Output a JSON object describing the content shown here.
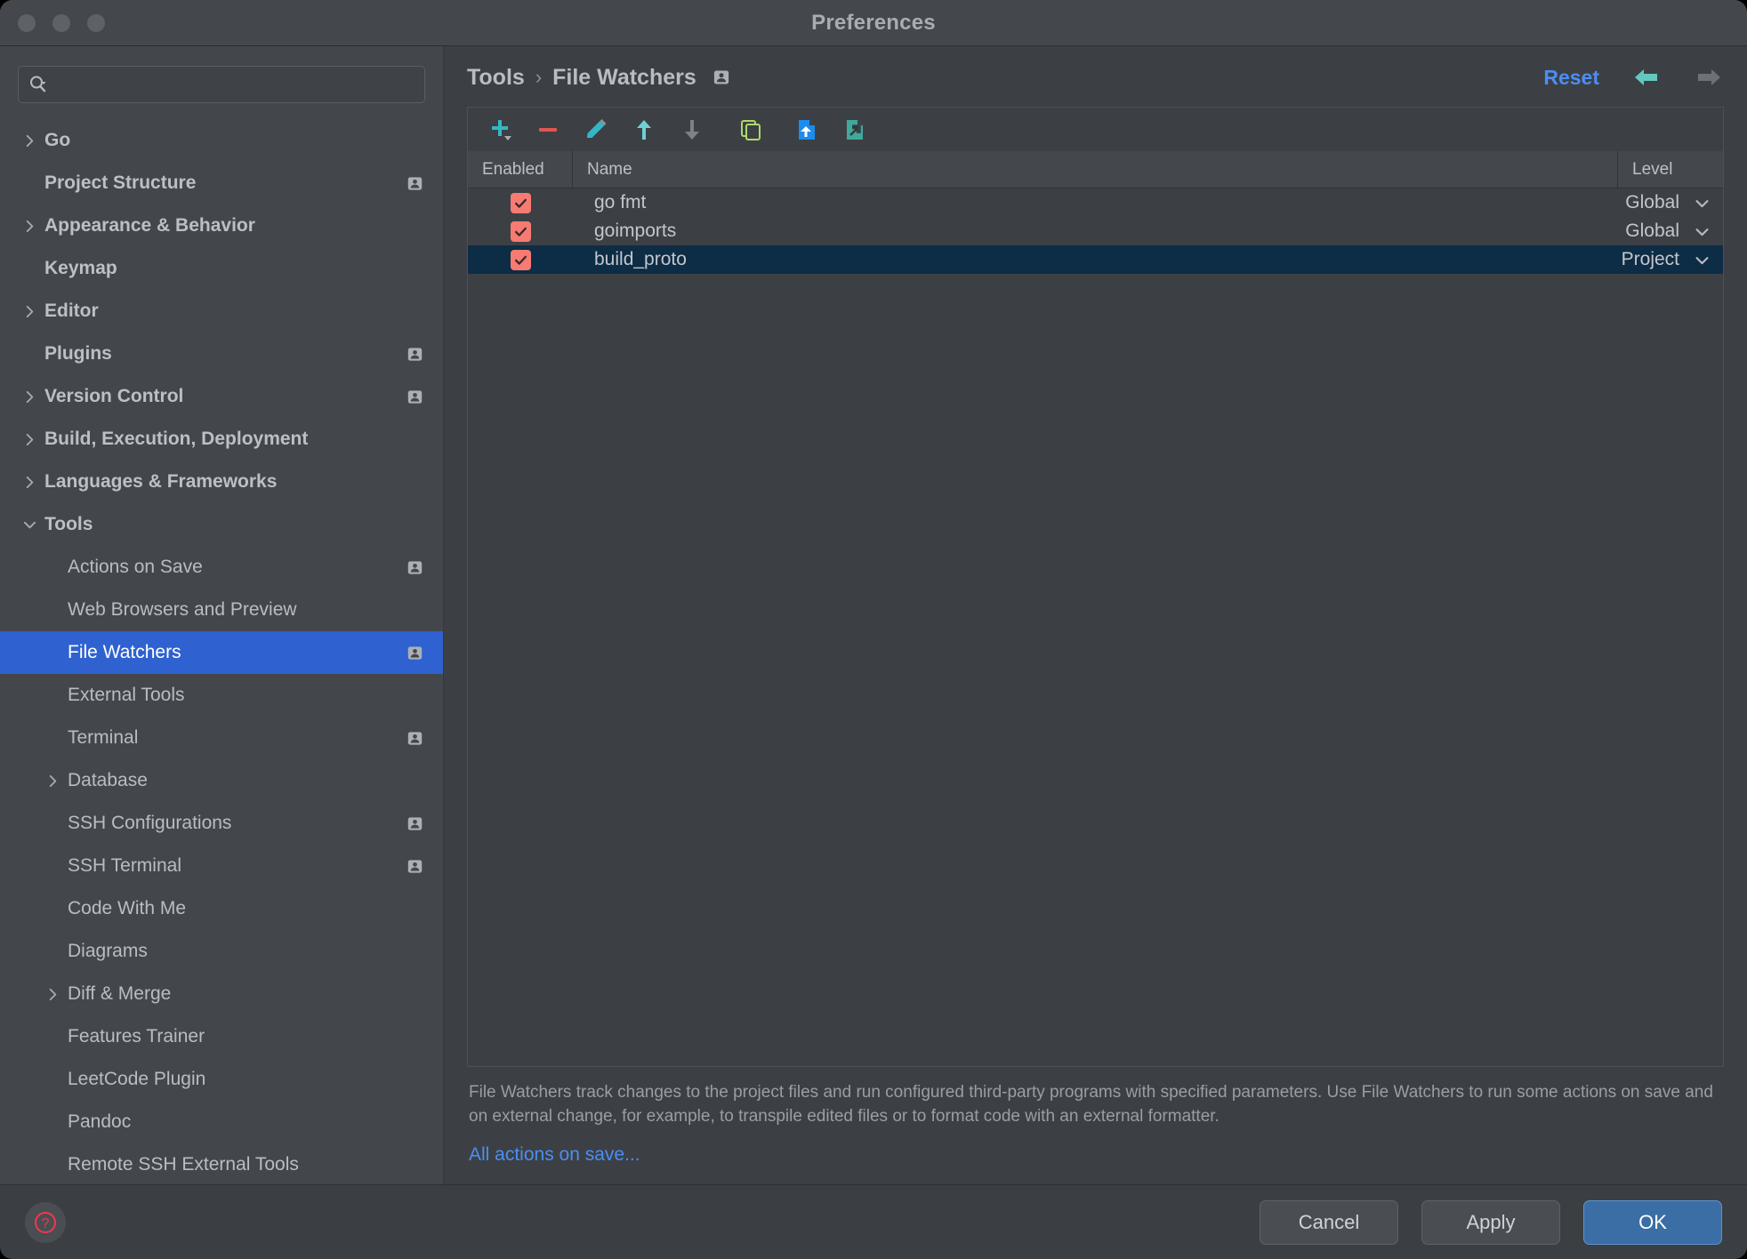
{
  "window": {
    "title": "Preferences",
    "traffic_lights": [
      "close",
      "minimize",
      "zoom"
    ]
  },
  "search": {
    "placeholder": "",
    "value": "",
    "icon": "search-icon"
  },
  "sidebar": {
    "items": [
      {
        "label": "Go",
        "level": 0,
        "expandable": true,
        "expanded": false,
        "bold": true,
        "badge": false,
        "selected": false
      },
      {
        "label": "Project Structure",
        "level": 0,
        "expandable": false,
        "expanded": false,
        "bold": true,
        "badge": true,
        "selected": false
      },
      {
        "label": "Appearance & Behavior",
        "level": 0,
        "expandable": true,
        "expanded": false,
        "bold": true,
        "badge": false,
        "selected": false
      },
      {
        "label": "Keymap",
        "level": 0,
        "expandable": false,
        "expanded": false,
        "bold": true,
        "badge": false,
        "selected": false
      },
      {
        "label": "Editor",
        "level": 0,
        "expandable": true,
        "expanded": false,
        "bold": true,
        "badge": false,
        "selected": false
      },
      {
        "label": "Plugins",
        "level": 0,
        "expandable": false,
        "expanded": false,
        "bold": true,
        "badge": true,
        "selected": false
      },
      {
        "label": "Version Control",
        "level": 0,
        "expandable": true,
        "expanded": false,
        "bold": true,
        "badge": true,
        "selected": false
      },
      {
        "label": "Build, Execution, Deployment",
        "level": 0,
        "expandable": true,
        "expanded": false,
        "bold": true,
        "badge": false,
        "selected": false
      },
      {
        "label": "Languages & Frameworks",
        "level": 0,
        "expandable": true,
        "expanded": false,
        "bold": true,
        "badge": false,
        "selected": false
      },
      {
        "label": "Tools",
        "level": 0,
        "expandable": true,
        "expanded": true,
        "bold": true,
        "badge": false,
        "selected": false
      },
      {
        "label": "Actions on Save",
        "level": 1,
        "expandable": false,
        "expanded": false,
        "bold": false,
        "badge": true,
        "selected": false
      },
      {
        "label": "Web Browsers and Preview",
        "level": 1,
        "expandable": false,
        "expanded": false,
        "bold": false,
        "badge": false,
        "selected": false
      },
      {
        "label": "File Watchers",
        "level": 1,
        "expandable": false,
        "expanded": false,
        "bold": false,
        "badge": true,
        "selected": true
      },
      {
        "label": "External Tools",
        "level": 1,
        "expandable": false,
        "expanded": false,
        "bold": false,
        "badge": false,
        "selected": false
      },
      {
        "label": "Terminal",
        "level": 1,
        "expandable": false,
        "expanded": false,
        "bold": false,
        "badge": true,
        "selected": false
      },
      {
        "label": "Database",
        "level": 1,
        "expandable": true,
        "expanded": false,
        "bold": false,
        "badge": false,
        "selected": false
      },
      {
        "label": "SSH Configurations",
        "level": 1,
        "expandable": false,
        "expanded": false,
        "bold": false,
        "badge": true,
        "selected": false
      },
      {
        "label": "SSH Terminal",
        "level": 1,
        "expandable": false,
        "expanded": false,
        "bold": false,
        "badge": true,
        "selected": false
      },
      {
        "label": "Code With Me",
        "level": 1,
        "expandable": false,
        "expanded": false,
        "bold": false,
        "badge": false,
        "selected": false
      },
      {
        "label": "Diagrams",
        "level": 1,
        "expandable": false,
        "expanded": false,
        "bold": false,
        "badge": false,
        "selected": false
      },
      {
        "label": "Diff & Merge",
        "level": 1,
        "expandable": true,
        "expanded": false,
        "bold": false,
        "badge": false,
        "selected": false
      },
      {
        "label": "Features Trainer",
        "level": 1,
        "expandable": false,
        "expanded": false,
        "bold": false,
        "badge": false,
        "selected": false
      },
      {
        "label": "LeetCode Plugin",
        "level": 1,
        "expandable": false,
        "expanded": false,
        "bold": false,
        "badge": false,
        "selected": false
      },
      {
        "label": "Pandoc",
        "level": 1,
        "expandable": false,
        "expanded": false,
        "bold": false,
        "badge": false,
        "selected": false
      },
      {
        "label": "Remote SSH External Tools",
        "level": 1,
        "expandable": false,
        "expanded": false,
        "bold": false,
        "badge": false,
        "selected": false
      }
    ]
  },
  "breadcrumb": {
    "parent": "Tools",
    "separator": "›",
    "current": "File Watchers",
    "badge_icon": "project-scope-badge-icon"
  },
  "header_actions": {
    "reset_label": "Reset",
    "back_icon": "arrow-left-icon",
    "forward_icon": "arrow-right-icon",
    "back_enabled": true,
    "forward_enabled": false
  },
  "toolbar": {
    "buttons": [
      {
        "name": "add-watcher-button",
        "icon": "plus-icon",
        "tooltip": "Add",
        "color": "#35b6c4",
        "enabled": true,
        "has_dropdown": true
      },
      {
        "name": "remove-watcher-button",
        "icon": "minus-icon",
        "tooltip": "Remove",
        "color": "#e2564f",
        "enabled": true,
        "has_dropdown": false
      },
      {
        "name": "edit-watcher-button",
        "icon": "pencil-icon",
        "tooltip": "Edit",
        "color": "#35b6c4",
        "enabled": true,
        "has_dropdown": false
      },
      {
        "name": "move-up-button",
        "icon": "arrow-up-icon",
        "tooltip": "Move Up",
        "color": "#6fcfd4",
        "enabled": true,
        "has_dropdown": false
      },
      {
        "name": "move-down-button",
        "icon": "arrow-down-icon",
        "tooltip": "Move Down",
        "color": "#7d8287",
        "enabled": false,
        "has_dropdown": false
      },
      {
        "name": "copy-watcher-button",
        "icon": "copy-icon",
        "tooltip": "Copy",
        "color": "#afd86a",
        "enabled": true,
        "has_dropdown": false
      },
      {
        "name": "import-watcher-button",
        "icon": "import-file-icon",
        "tooltip": "Import",
        "color": "#1c8ced",
        "enabled": true,
        "has_dropdown": false
      },
      {
        "name": "export-watcher-button",
        "icon": "export-file-icon",
        "tooltip": "Export",
        "color": "#3fa99b",
        "enabled": true,
        "has_dropdown": false
      }
    ]
  },
  "table": {
    "columns": [
      "Enabled",
      "Name",
      "Level"
    ],
    "rows": [
      {
        "enabled": true,
        "name": "go fmt",
        "level": "Global",
        "selected": false
      },
      {
        "enabled": true,
        "name": "goimports",
        "level": "Global",
        "selected": false
      },
      {
        "enabled": true,
        "name": "build_proto",
        "level": "Project",
        "selected": true
      }
    ]
  },
  "description": {
    "text": "File Watchers track changes to the project files and run configured third-party programs with specified parameters. Use File Watchers to run some actions on save and on external change, for example, to transpile edited files or to format code with an external formatter.",
    "link_label": "All actions on save..."
  },
  "footer": {
    "help_icon": "help-question-icon",
    "cancel_label": "Cancel",
    "apply_label": "Apply",
    "ok_label": "OK"
  },
  "colors": {
    "accent_blue": "#4d8df4",
    "selection_blue": "#2f62d0",
    "row_selection": "#0d2c45",
    "checkbox_red": "#f77b72",
    "teal": "#35b6c4",
    "ok_button": "#3a6ea5",
    "help_red": "#f2374f"
  }
}
